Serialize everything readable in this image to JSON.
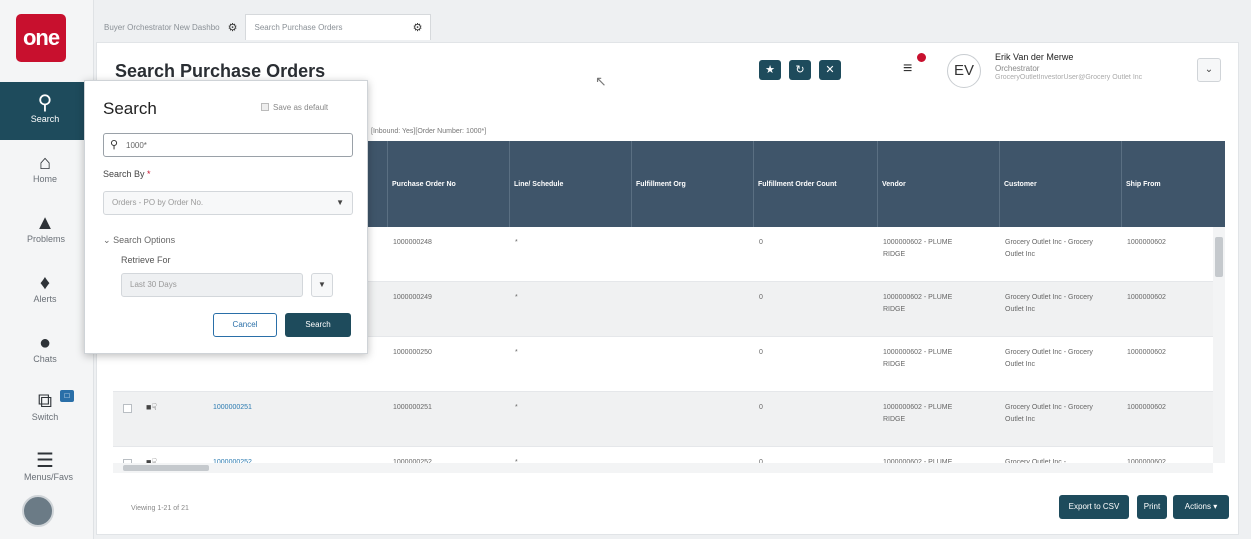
{
  "app": {
    "logo_text": "one",
    "accent": "#1e4b5c",
    "brand": "#c8102e"
  },
  "nav": [
    {
      "label": "Search",
      "icon": "search-icon",
      "glyph": "🔍"
    },
    {
      "label": "Home",
      "icon": "home-icon",
      "glyph": "🏠"
    },
    {
      "label": "Problems",
      "icon": "warning-icon",
      "glyph": "▲"
    },
    {
      "label": "Alerts",
      "icon": "bell-icon",
      "glyph": "🔔"
    },
    {
      "label": "Chats",
      "icon": "chat-icon",
      "glyph": "💬"
    },
    {
      "label": "Switch",
      "icon": "switch-icon",
      "glyph": "⧉"
    },
    {
      "label": "Menus/Favs",
      "icon": "menu-icon",
      "glyph": "☰"
    }
  ],
  "tabs": [
    {
      "label": "Buyer Orchestrator New Dashbo"
    },
    {
      "label": "Search Purchase Orders"
    }
  ],
  "page": {
    "title": "Search Purchase Orders"
  },
  "user": {
    "initials": "EV",
    "name": "Erik Van der Merwe",
    "role": "Orchestrator",
    "email": "GroceryOutletInvestorUser@Grocery Outlet Inc"
  },
  "filter_text": "[Inbound: Yes][Order Number: 1000*]",
  "grid": {
    "headers": [
      "Purchase Order No",
      "Line/ Schedule",
      "Fulfillment Org",
      "Fulfillment Order Count",
      "Vendor",
      "Customer",
      "Ship From"
    ],
    "rows": [
      {
        "link": "",
        "po": "1000000248",
        "line": "*",
        "count": "0",
        "vendor": "1000000602 - PLUME RIDGE",
        "customer": "Grocery Outlet Inc - Grocery Outlet Inc",
        "ship_from": "1000000602"
      },
      {
        "link": "",
        "po": "1000000249",
        "line": "*",
        "count": "0",
        "vendor": "1000000602 - PLUME RIDGE",
        "customer": "Grocery Outlet Inc - Grocery Outlet Inc",
        "ship_from": "1000000602"
      },
      {
        "link": "",
        "po": "1000000250",
        "line": "*",
        "count": "0",
        "vendor": "1000000602 - PLUME RIDGE",
        "customer": "Grocery Outlet Inc - Grocery Outlet Inc",
        "ship_from": "1000000602"
      },
      {
        "link": "1000000251",
        "po": "1000000251",
        "line": "*",
        "count": "0",
        "vendor": "1000000602 - PLUME RIDGE",
        "customer": "Grocery Outlet Inc - Grocery Outlet Inc",
        "ship_from": "1000000602"
      },
      {
        "link": "1000000252",
        "po": "1000000252",
        "line": "*",
        "count": "0",
        "vendor": "1000000602 - PLUME",
        "customer": "Grocery Outlet Inc -",
        "ship_from": "1000000602"
      }
    ]
  },
  "footer": {
    "viewing": "Viewing 1-21 of 21",
    "export": "Export to CSV",
    "print": "Print",
    "actions": "Actions ▾"
  },
  "search_panel": {
    "title": "Search",
    "save_default": "Save as default",
    "query": "1000*",
    "search_by_label": "Search By",
    "search_by_value": "Orders - PO by Order No.",
    "options_label": "Search Options",
    "retrieve_label": "Retrieve For",
    "retrieve_value": "Last 30 Days",
    "cancel": "Cancel",
    "submit": "Search"
  }
}
